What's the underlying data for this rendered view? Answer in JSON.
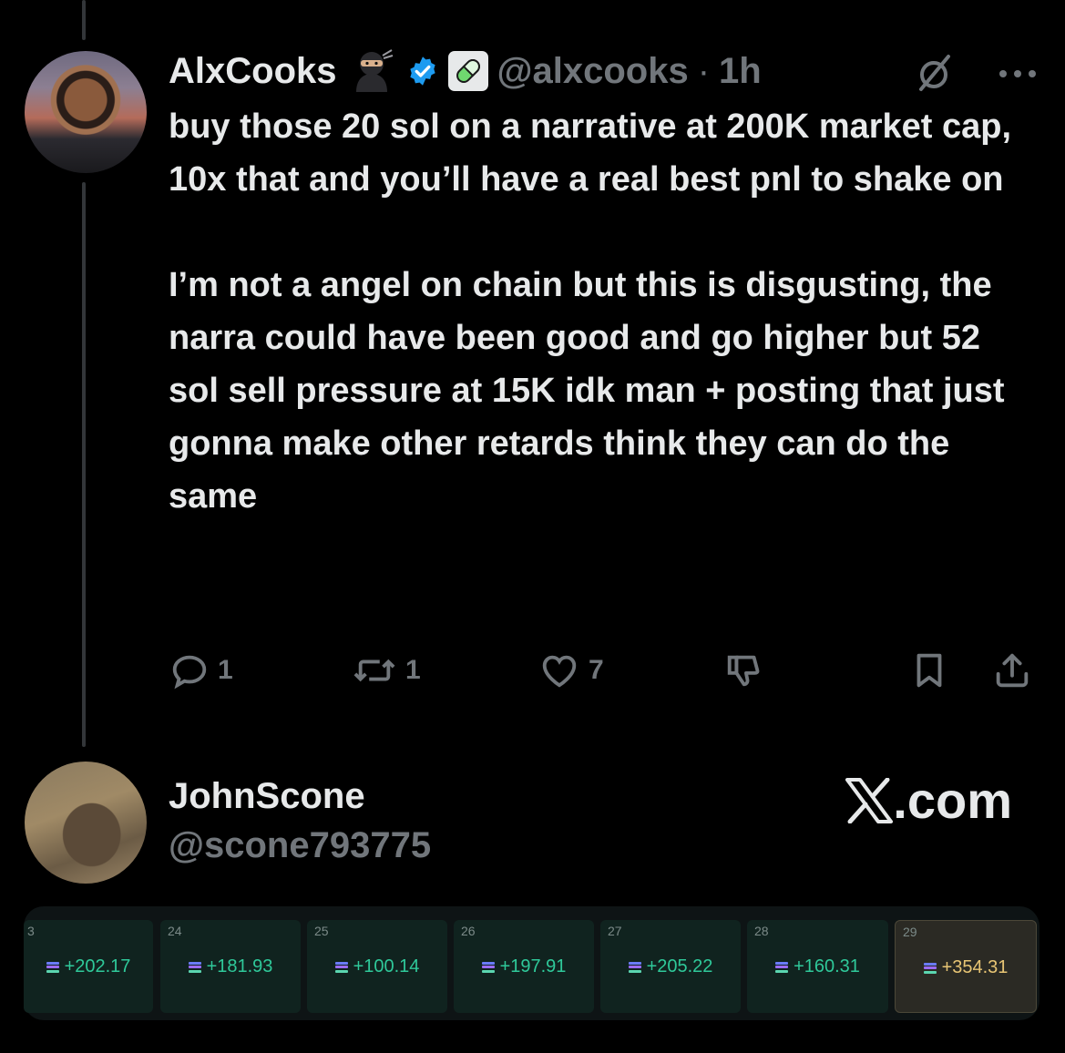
{
  "tweet": {
    "author": {
      "display_name": "AlxCooks",
      "handle": "@alxcooks",
      "emoji": "ninja-emoji",
      "verified": true,
      "badge": "pill-badge"
    },
    "separator": "·",
    "time": "1h",
    "text": {
      "paragraph1": "buy those 20 sol on a narrative at 200K market cap, 10x that and you’ll have a real best pnl to shake on",
      "paragraph2": "I’m not a angel on chain but this is disgusting, the narra could have been good and go higher but 52 sol sell pressure at 15K idk man + posting that just gonna make other retards think they can do the same"
    },
    "actions": {
      "replies": "1",
      "reposts": "1",
      "likes": "7"
    }
  },
  "profile": {
    "display_name": "JohnScone",
    "handle": "@scone793775"
  },
  "brand": {
    "label": ".com"
  },
  "pnl_calendar": {
    "cells": [
      {
        "day": "3",
        "value": "+202.17"
      },
      {
        "day": "24",
        "value": "+181.93"
      },
      {
        "day": "25",
        "value": "+100.14"
      },
      {
        "day": "26",
        "value": "+197.91"
      },
      {
        "day": "27",
        "value": "+205.22"
      },
      {
        "day": "28",
        "value": "+160.31"
      },
      {
        "day": "29",
        "value": "+354.31"
      }
    ]
  },
  "colors": {
    "background": "#000000",
    "text": "#e7e9ea",
    "muted": "#71767b",
    "verified": "#1d9bf0",
    "pnl_positive": "#2fc99a",
    "pnl_highlight": "#e8c574"
  }
}
